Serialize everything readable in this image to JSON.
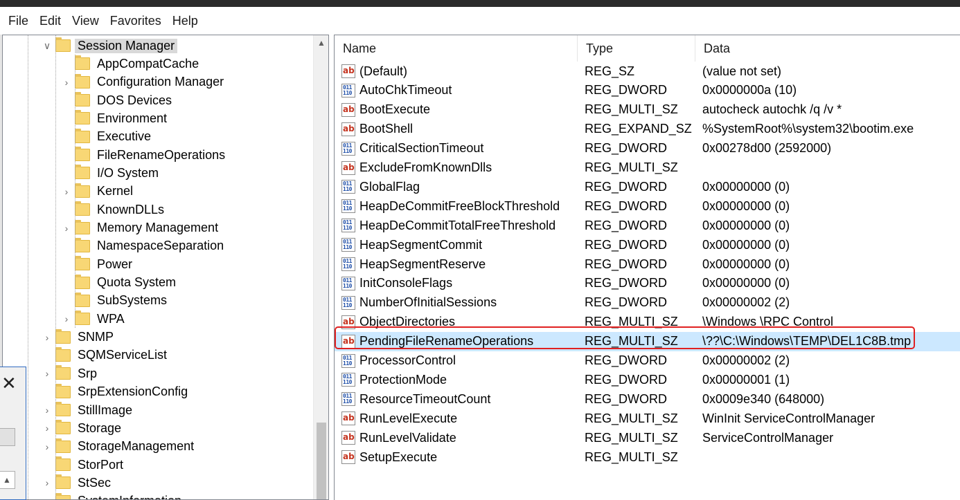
{
  "menu": [
    "File",
    "Edit",
    "View",
    "Favorites",
    "Help"
  ],
  "tree": {
    "parent": "Session Manager",
    "children": [
      {
        "label": "AppCompatCache",
        "expandable": false
      },
      {
        "label": "Configuration Manager",
        "expandable": true
      },
      {
        "label": "DOS Devices",
        "expandable": false
      },
      {
        "label": "Environment",
        "expandable": false
      },
      {
        "label": "Executive",
        "expandable": false
      },
      {
        "label": "FileRenameOperations",
        "expandable": false
      },
      {
        "label": "I/O System",
        "expandable": false
      },
      {
        "label": "Kernel",
        "expandable": true
      },
      {
        "label": "KnownDLLs",
        "expandable": false
      },
      {
        "label": "Memory Management",
        "expandable": true
      },
      {
        "label": "NamespaceSeparation",
        "expandable": false
      },
      {
        "label": "Power",
        "expandable": false
      },
      {
        "label": "Quota System",
        "expandable": false
      },
      {
        "label": "SubSystems",
        "expandable": false
      },
      {
        "label": "WPA",
        "expandable": true
      }
    ],
    "siblings": [
      {
        "label": "SNMP",
        "expandable": true
      },
      {
        "label": "SQMServiceList",
        "expandable": false
      },
      {
        "label": "Srp",
        "expandable": true
      },
      {
        "label": "SrpExtensionConfig",
        "expandable": false
      },
      {
        "label": "StillImage",
        "expandable": true
      },
      {
        "label": "Storage",
        "expandable": true
      },
      {
        "label": "StorageManagement",
        "expandable": true
      },
      {
        "label": "StorPort",
        "expandable": false
      },
      {
        "label": "StSec",
        "expandable": true
      },
      {
        "label": "SystemInformation",
        "expandable": false
      }
    ]
  },
  "columns": {
    "name": "Name",
    "type": "Type",
    "data": "Data"
  },
  "values": [
    {
      "icon": "string",
      "name": "(Default)",
      "type": "REG_SZ",
      "data": "(value not set)"
    },
    {
      "icon": "binary",
      "name": "AutoChkTimeout",
      "type": "REG_DWORD",
      "data": "0x0000000a (10)"
    },
    {
      "icon": "string",
      "name": "BootExecute",
      "type": "REG_MULTI_SZ",
      "data": "autocheck autochk /q /v *"
    },
    {
      "icon": "string",
      "name": "BootShell",
      "type": "REG_EXPAND_SZ",
      "data": "%SystemRoot%\\system32\\bootim.exe"
    },
    {
      "icon": "binary",
      "name": "CriticalSectionTimeout",
      "type": "REG_DWORD",
      "data": "0x00278d00 (2592000)"
    },
    {
      "icon": "string",
      "name": "ExcludeFromKnownDlls",
      "type": "REG_MULTI_SZ",
      "data": ""
    },
    {
      "icon": "binary",
      "name": "GlobalFlag",
      "type": "REG_DWORD",
      "data": "0x00000000 (0)"
    },
    {
      "icon": "binary",
      "name": "HeapDeCommitFreeBlockThreshold",
      "type": "REG_DWORD",
      "data": "0x00000000 (0)"
    },
    {
      "icon": "binary",
      "name": "HeapDeCommitTotalFreeThreshold",
      "type": "REG_DWORD",
      "data": "0x00000000 (0)"
    },
    {
      "icon": "binary",
      "name": "HeapSegmentCommit",
      "type": "REG_DWORD",
      "data": "0x00000000 (0)"
    },
    {
      "icon": "binary",
      "name": "HeapSegmentReserve",
      "type": "REG_DWORD",
      "data": "0x00000000 (0)"
    },
    {
      "icon": "binary",
      "name": "InitConsoleFlags",
      "type": "REG_DWORD",
      "data": "0x00000000 (0)"
    },
    {
      "icon": "binary",
      "name": "NumberOfInitialSessions",
      "type": "REG_DWORD",
      "data": "0x00000002 (2)"
    },
    {
      "icon": "string",
      "name": "ObjectDirectories",
      "type": "REG_MULTI_SZ",
      "data": "\\Windows \\RPC Control"
    },
    {
      "icon": "string",
      "name": "PendingFileRenameOperations",
      "type": "REG_MULTI_SZ",
      "data": "\\??\\C:\\Windows\\TEMP\\DEL1C8B.tmp",
      "selected": true
    },
    {
      "icon": "binary",
      "name": "ProcessorControl",
      "type": "REG_DWORD",
      "data": "0x00000002 (2)"
    },
    {
      "icon": "binary",
      "name": "ProtectionMode",
      "type": "REG_DWORD",
      "data": "0x00000001 (1)"
    },
    {
      "icon": "binary",
      "name": "ResourceTimeoutCount",
      "type": "REG_DWORD",
      "data": "0x0009e340 (648000)"
    },
    {
      "icon": "string",
      "name": "RunLevelExecute",
      "type": "REG_MULTI_SZ",
      "data": "WinInit ServiceControlManager"
    },
    {
      "icon": "string",
      "name": "RunLevelValidate",
      "type": "REG_MULTI_SZ",
      "data": "ServiceControlManager"
    },
    {
      "icon": "string",
      "name": "SetupExecute",
      "type": "REG_MULTI_SZ",
      "data": ""
    }
  ],
  "icon_text": {
    "string": "ab",
    "binary": "011\n110"
  },
  "colors": {
    "selection": "#cce8ff",
    "highlight_outline": "#e02020",
    "string_icon": "#c4321d",
    "binary_icon": "#1f4fa8"
  }
}
